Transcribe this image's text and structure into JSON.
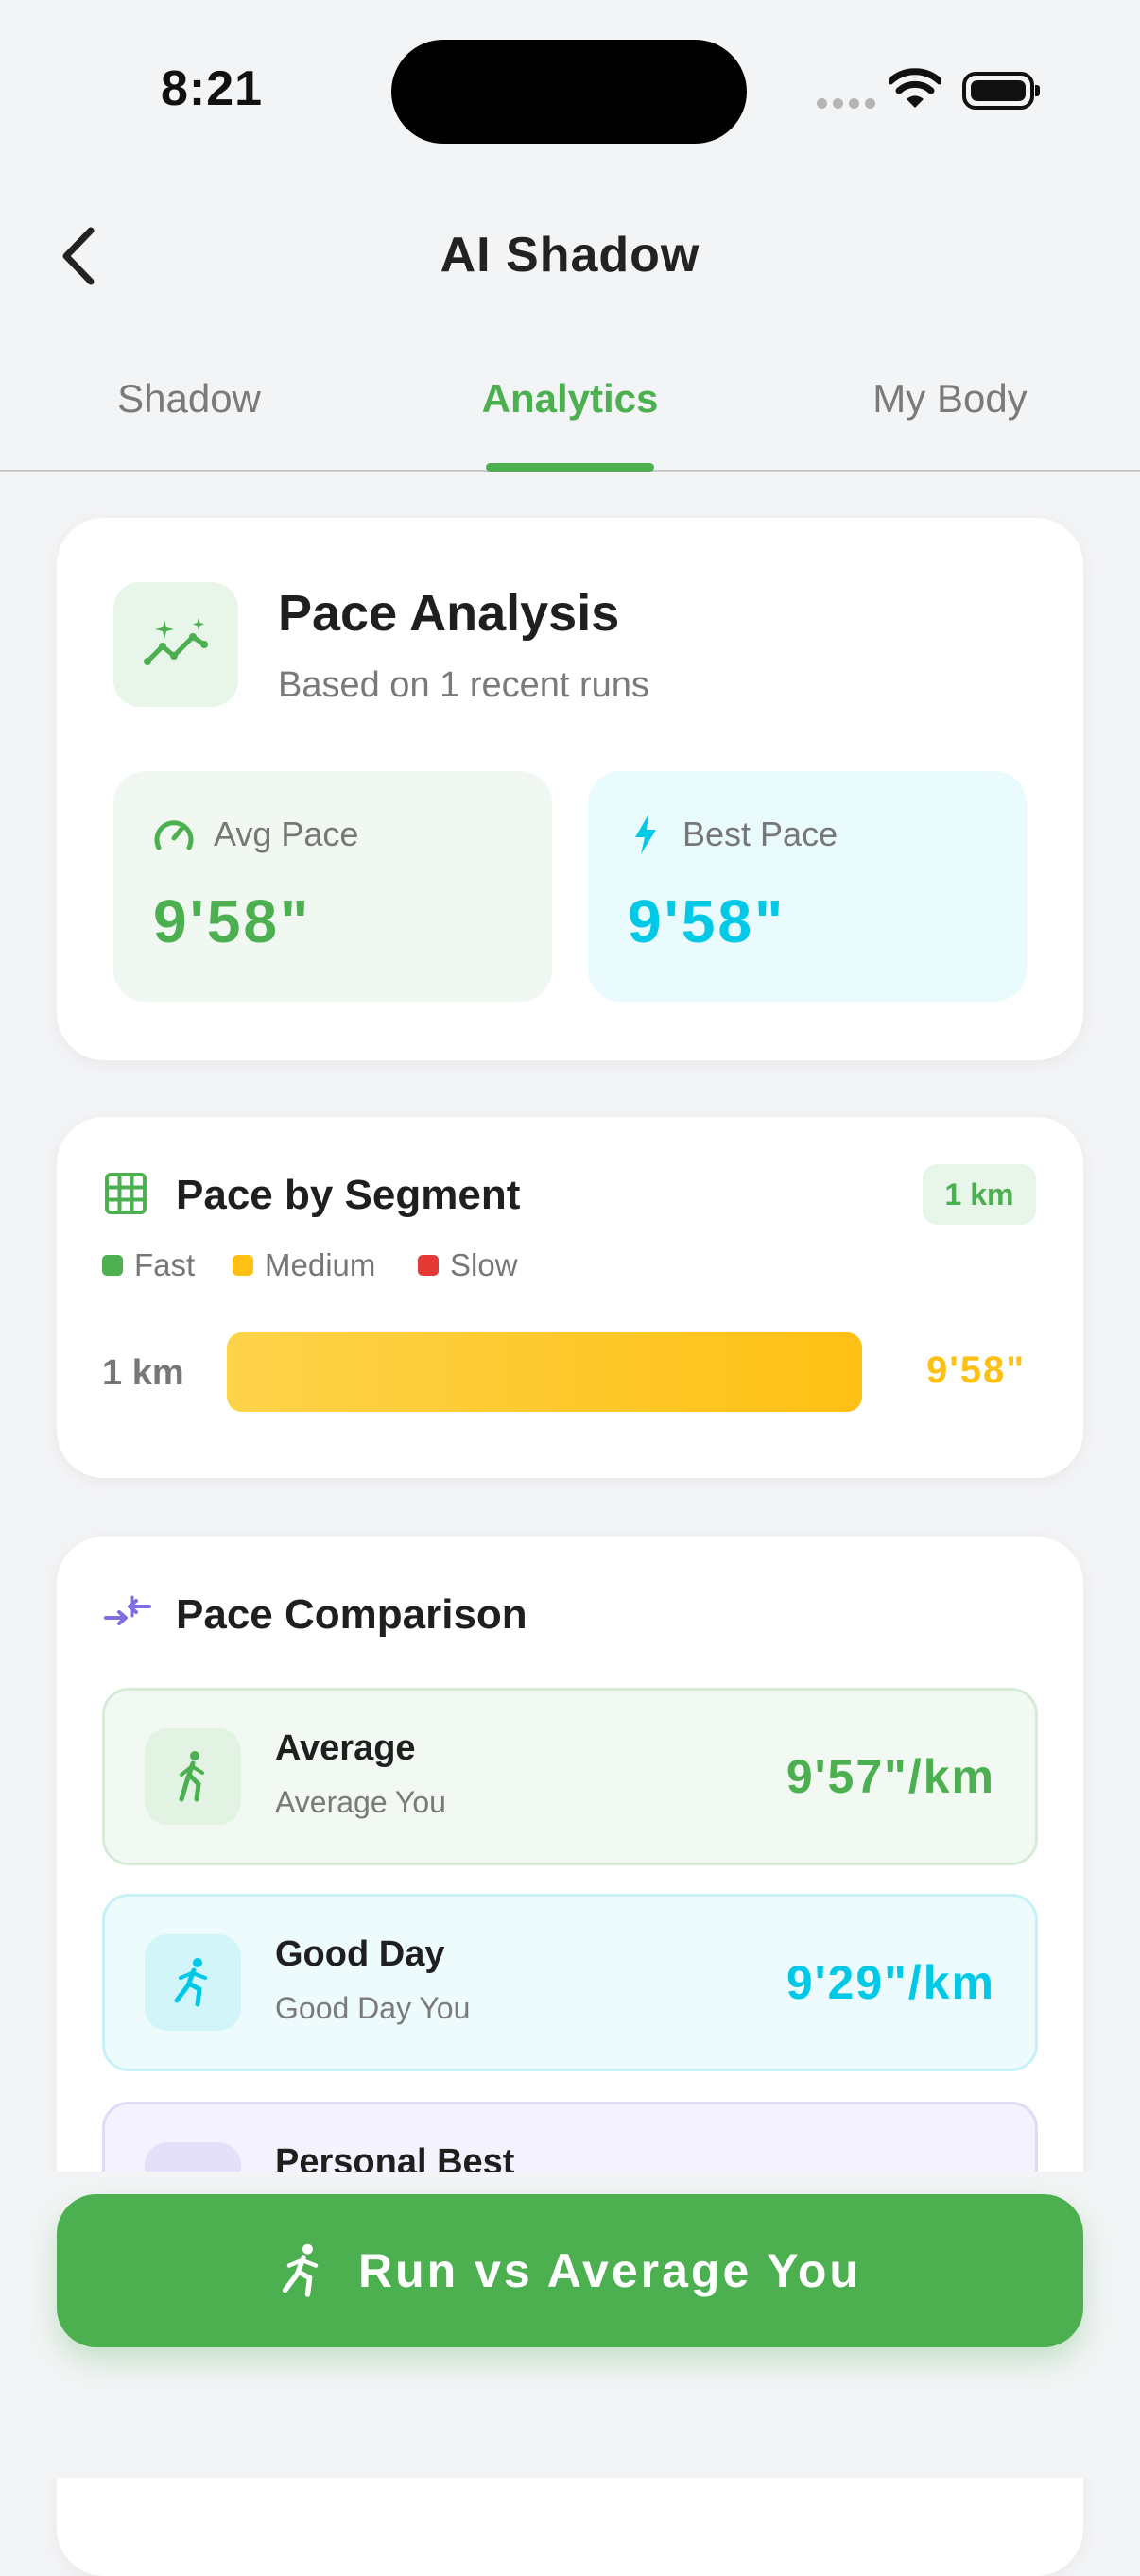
{
  "status": {
    "time": "8:21"
  },
  "nav": {
    "title": "AI Shadow"
  },
  "tabs": [
    {
      "label": "Shadow"
    },
    {
      "label": "Analytics"
    },
    {
      "label": "My Body"
    }
  ],
  "pace_analysis": {
    "title": "Pace Analysis",
    "subtitle": "Based on 1 recent runs",
    "avg_label": "Avg Pace",
    "avg_value": "9'58\"",
    "best_label": "Best Pace",
    "best_value": "9'58\""
  },
  "segments": {
    "title": "Pace by Segment",
    "badge": "1 km",
    "legend": [
      {
        "label": "Fast",
        "color": "#4caf50"
      },
      {
        "label": "Medium",
        "color": "#fec013"
      },
      {
        "label": "Slow",
        "color": "#e53935"
      }
    ],
    "rows": [
      {
        "label": "1 km",
        "value": "9'58\"",
        "fill_fraction": 1.0
      }
    ]
  },
  "comparison": {
    "title": "Pace Comparison",
    "items": [
      {
        "title": "Average",
        "subtitle": "Average You",
        "value": "9'57\"/km",
        "color": "#4caf50"
      },
      {
        "title": "Good Day",
        "subtitle": "Good Day You",
        "value": "9'29\"/km",
        "color": "#00c9e8"
      },
      {
        "title": "Personal Best",
        "subtitle": "",
        "value": "",
        "color": "#7e6ee0"
      }
    ]
  },
  "cta": {
    "label": "Run vs Average You"
  },
  "colors": {
    "accent": "#4caf50",
    "cyan": "#00c9e8",
    "yellow": "#fec013",
    "purple": "#7e6ee0"
  }
}
